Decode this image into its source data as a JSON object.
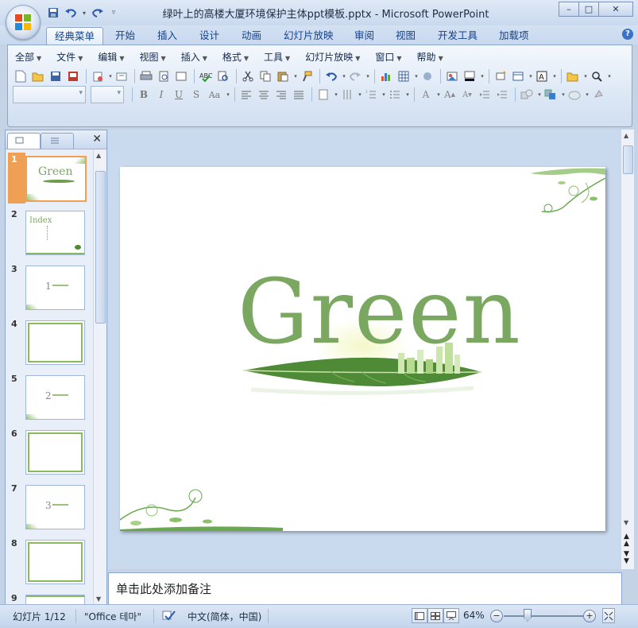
{
  "window": {
    "title": "绿叶上的高楼大厦环境保护主体ppt模板.pptx - Microsoft PowerPoint",
    "buttons": {
      "minimize": "–",
      "maximize": "□",
      "close": "✕"
    }
  },
  "quick_access": {
    "items": [
      "save-icon",
      "undo-icon",
      "redo-icon",
      "customize-icon"
    ]
  },
  "tabs": [
    {
      "label": "经典菜单",
      "active": true
    },
    {
      "label": "开始"
    },
    {
      "label": "插入"
    },
    {
      "label": "设计"
    },
    {
      "label": "动画"
    },
    {
      "label": "幻灯片放映"
    },
    {
      "label": "审阅"
    },
    {
      "label": "视图"
    },
    {
      "label": "开发工具"
    },
    {
      "label": "加载项"
    }
  ],
  "menus": [
    {
      "label": "全部"
    },
    {
      "label": "文件"
    },
    {
      "label": "编辑"
    },
    {
      "label": "视图"
    },
    {
      "label": "插入"
    },
    {
      "label": "格式"
    },
    {
      "label": "工具"
    },
    {
      "label": "幻灯片放映"
    },
    {
      "label": "窗口"
    },
    {
      "label": "帮助"
    }
  ],
  "slides": [
    {
      "num": "1",
      "kind": "title",
      "text": "Green"
    },
    {
      "num": "2",
      "kind": "index",
      "text": "Index"
    },
    {
      "num": "3",
      "kind": "section",
      "text": "1"
    },
    {
      "num": "4",
      "kind": "framed"
    },
    {
      "num": "5",
      "kind": "section",
      "text": "2"
    },
    {
      "num": "6",
      "kind": "framed"
    },
    {
      "num": "7",
      "kind": "section",
      "text": "3"
    },
    {
      "num": "8",
      "kind": "framed"
    },
    {
      "num": "9",
      "kind": "partial"
    }
  ],
  "slide": {
    "title": "Green"
  },
  "notes": {
    "placeholder": "单击此处添加备注"
  },
  "status": {
    "slide": "幻灯片 1/12",
    "theme": "\"Office 테마\"",
    "language": "中文(简体，中国)",
    "zoom": "64%"
  },
  "colors": {
    "accent_green": "#7aa860",
    "ribbon_blue": "#c4d3e6",
    "selection_orange": "#f0a055"
  }
}
